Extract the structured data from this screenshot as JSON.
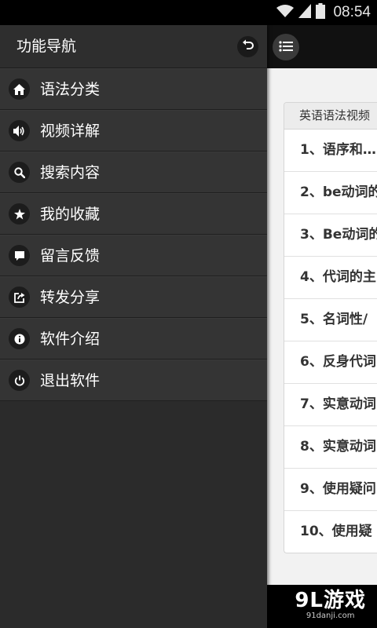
{
  "status_bar": {
    "time": "08:54"
  },
  "drawer": {
    "title": "功能导航",
    "items": [
      {
        "label": "语法分类",
        "icon": "home-icon"
      },
      {
        "label": "视频详解",
        "icon": "speaker-icon"
      },
      {
        "label": "搜索内容",
        "icon": "search-icon"
      },
      {
        "label": "我的收藏",
        "icon": "star-icon"
      },
      {
        "label": "留言反馈",
        "icon": "comment-icon"
      },
      {
        "label": "转发分享",
        "icon": "share-icon"
      },
      {
        "label": "软件介绍",
        "icon": "info-icon"
      },
      {
        "label": "退出软件",
        "icon": "power-icon"
      }
    ]
  },
  "main": {
    "card_header": "英语语法视频",
    "rows": [
      "1、语序和…",
      "2、be动词的",
      "3、Be动词的",
      "4、代词的主",
      "5、名词性/",
      "6、反身代词",
      "7、实意动词",
      "8、实意动词",
      "9、使用疑问",
      "10、使用疑"
    ]
  },
  "watermark": {
    "brand": "9L游戏",
    "url": "91danji.com"
  }
}
